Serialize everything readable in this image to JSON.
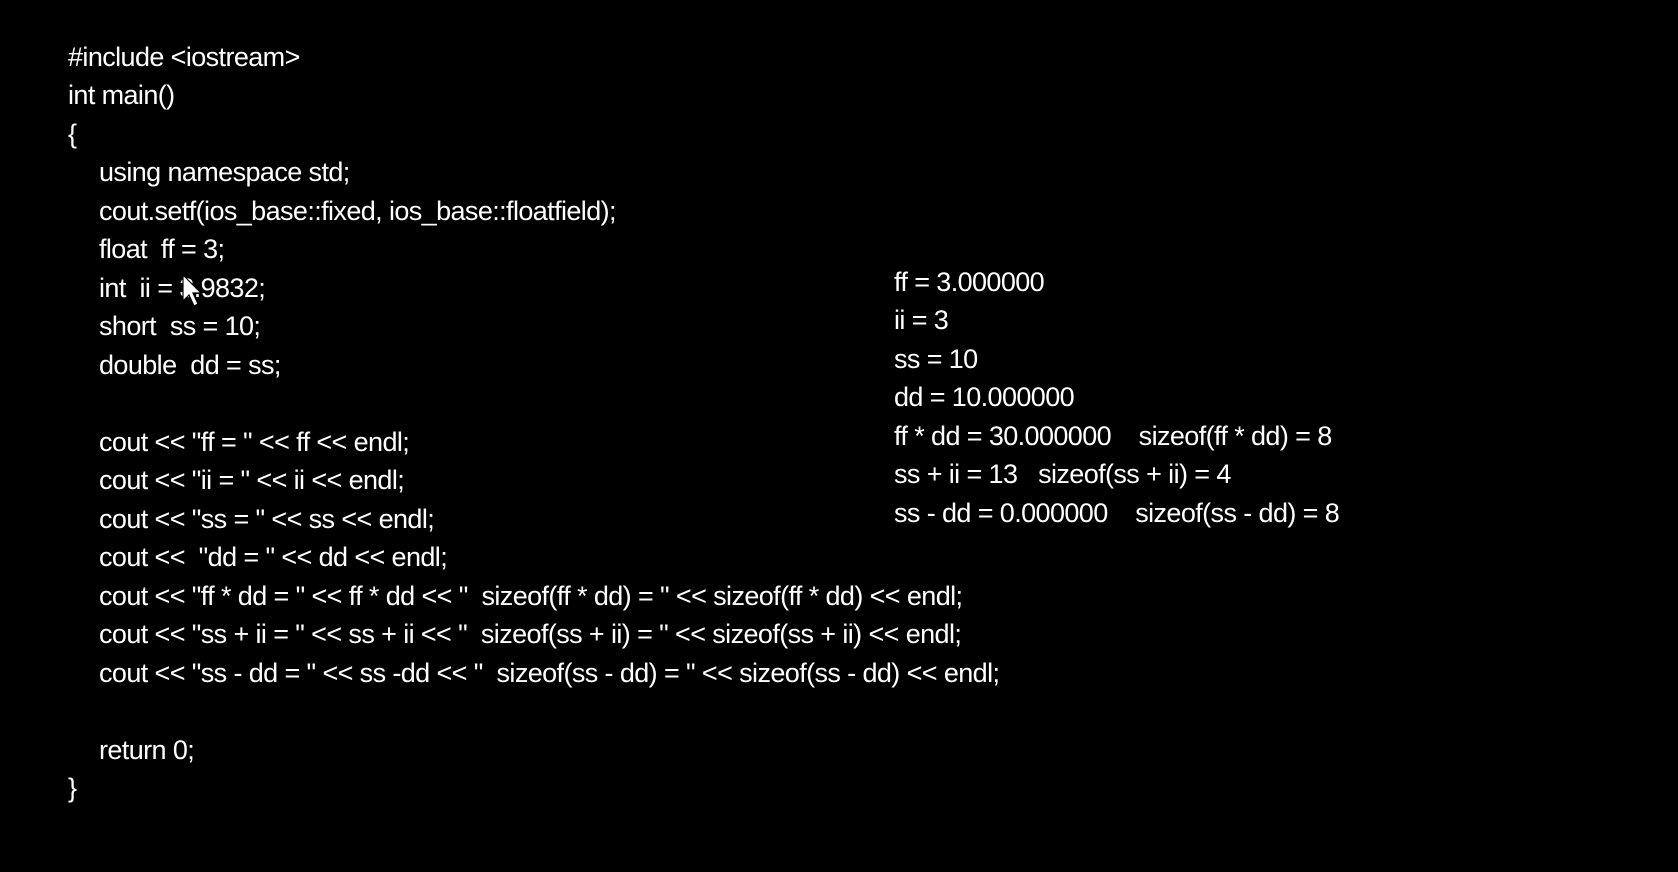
{
  "code": {
    "lines": [
      "#include <iostream>",
      "int main()",
      "{",
      "using namespace std;",
      "cout.setf(ios_base::fixed, ios_base::floatfield);",
      "float  ff = 3;",
      "int  ii = 3.9832;",
      "short  ss = 10;",
      "double  dd = ss;",
      "",
      "cout << \"ff = \" << ff << endl;",
      "cout << \"ii = \" << ii << endl;",
      "cout << \"ss = \" << ss << endl;",
      "cout <<  \"dd = \" << dd << endl;",
      "cout << \"ff * dd = \" << ff * dd << \"  sizeof(ff * dd) = \" << sizeof(ff * dd) << endl;",
      "cout << \"ss + ii = \" << ss + ii << \"  sizeof(ss + ii) = \" << sizeof(ss + ii) << endl;",
      "cout << \"ss - dd = \" << ss -dd << \"  sizeof(ss - dd) = \" << sizeof(ss - dd) << endl;",
      "",
      "return 0;",
      "}"
    ]
  },
  "output": {
    "lines": [
      "ff = 3.000000",
      "ii = 3",
      "ss = 10",
      "dd = 10.000000",
      "ff * dd = 30.000000    sizeof(ff * dd) = 8",
      "ss + ii = 13   sizeof(ss + ii) = 4",
      "ss - dd = 0.000000    sizeof(ss - dd) = 8"
    ]
  },
  "cursor": {
    "icon": "mouse-pointer-icon",
    "color": "#ffffff"
  },
  "colors": {
    "background": "#000000",
    "text": "#ffffff"
  }
}
